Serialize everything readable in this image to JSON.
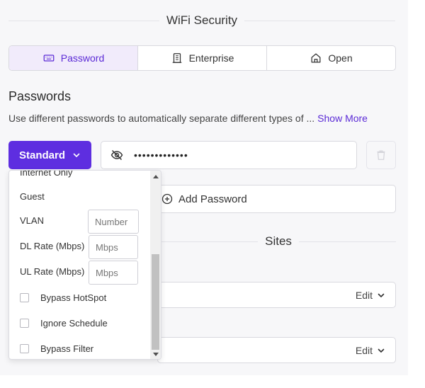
{
  "wifi_security": {
    "title": "WiFi Security",
    "tabs": [
      {
        "label": "Password",
        "icon": "keyboard-icon",
        "active": true
      },
      {
        "label": "Enterprise",
        "icon": "building-icon",
        "active": false
      },
      {
        "label": "Open",
        "icon": "home-icon",
        "active": false
      }
    ]
  },
  "passwords": {
    "title": "Passwords",
    "description": "Use different passwords to automatically separate different types of ...",
    "show_more": "Show More",
    "type_button": "Standard",
    "password_value": "•••••••••••••",
    "add_password": "Add Password"
  },
  "sites": {
    "title": "Sites",
    "edit_label": "Edit"
  },
  "dropdown": {
    "cut_item": "Internet Only",
    "guest": "Guest",
    "vlan_label": "VLAN",
    "vlan_placeholder": "Number",
    "dl_label": "DL Rate (Mbps)",
    "dl_placeholder": "Mbps",
    "ul_label": "UL Rate (Mbps)",
    "ul_placeholder": "Mbps",
    "bypass_hotspot": "Bypass HotSpot",
    "ignore_schedule": "Ignore Schedule",
    "bypass_filter": "Bypass Filter"
  },
  "colors": {
    "accent": "#5e2ee0",
    "active_tab_bg": "#f1ebfb",
    "panel_bg": "#f7f7f9"
  }
}
